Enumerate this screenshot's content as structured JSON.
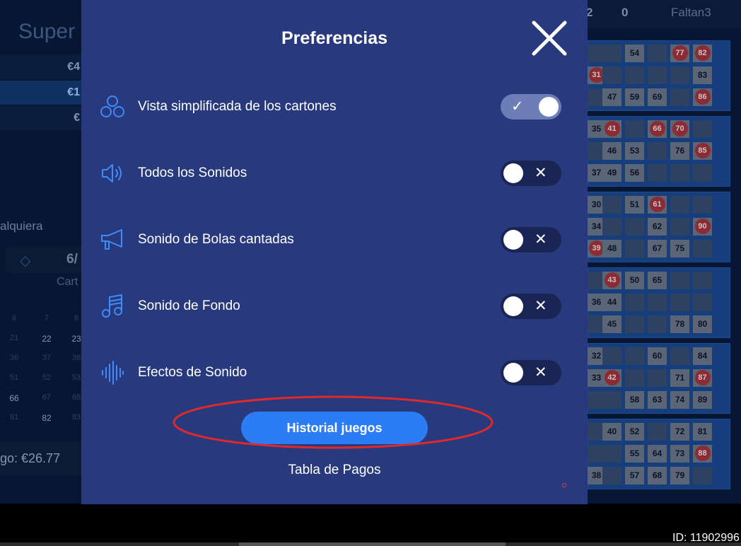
{
  "background": {
    "title": "Super",
    "prize_rows": [
      "€4",
      "€1",
      "€"
    ],
    "any_label": "alquiera",
    "selector_value": "6/",
    "cards_label": "Cart",
    "number_grid": [
      {
        "v": "6"
      },
      {
        "v": "7"
      },
      {
        "v": "8"
      },
      {
        "v": "21"
      },
      {
        "v": "22",
        "hi": true
      },
      {
        "v": "23",
        "hi": true
      },
      {
        "v": "36"
      },
      {
        "v": "37"
      },
      {
        "v": "38"
      },
      {
        "v": "51"
      },
      {
        "v": "52"
      },
      {
        "v": "53"
      },
      {
        "v": "66",
        "hi": true
      },
      {
        "v": "67"
      },
      {
        "v": "68"
      },
      {
        "v": "81"
      },
      {
        "v": "82",
        "hi": true
      },
      {
        "v": "83"
      }
    ],
    "bottom_label": "go: €26.77",
    "top_numbers": [
      "2",
      "0"
    ],
    "faltan": "Faltan3",
    "id_text": "ID: 11902996",
    "cards": [
      [
        [
          {
            "t": ""
          },
          {
            "t": ""
          },
          {
            "t": "54",
            "k": "num"
          },
          {
            "t": ""
          },
          {
            "t": "77",
            "k": "ball"
          },
          {
            "t": "82",
            "k": "ball"
          }
        ],
        [
          {
            "t": "31",
            "k": "ball"
          },
          {
            "t": ""
          },
          {
            "t": ""
          },
          {
            "t": ""
          },
          {
            "t": ""
          },
          {
            "t": "83",
            "k": "num"
          }
        ],
        [
          {
            "t": ""
          },
          {
            "t": "47",
            "k": "num"
          },
          {
            "t": "59",
            "k": "num"
          },
          {
            "t": "69",
            "k": "num"
          },
          {
            "t": ""
          },
          {
            "t": "86",
            "k": "ball"
          }
        ]
      ],
      [
        [
          {
            "t": "35",
            "k": "num"
          },
          {
            "t": "41",
            "k": "ball"
          },
          {
            "t": ""
          },
          {
            "t": "66",
            "k": "ball"
          },
          {
            "t": "70",
            "k": "ball"
          },
          {
            "t": ""
          }
        ],
        [
          {
            "t": ""
          },
          {
            "t": "46",
            "k": "num"
          },
          {
            "t": "53",
            "k": "num"
          },
          {
            "t": ""
          },
          {
            "t": "76",
            "k": "num"
          },
          {
            "t": "85",
            "k": "ball"
          }
        ],
        [
          {
            "t": "37",
            "k": "num"
          },
          {
            "t": "49",
            "k": "num"
          },
          {
            "t": "56",
            "k": "num"
          },
          {
            "t": ""
          },
          {
            "t": ""
          },
          {
            "t": ""
          }
        ]
      ],
      [
        [
          {
            "t": "30",
            "k": "num"
          },
          {
            "t": ""
          },
          {
            "t": "51",
            "k": "num"
          },
          {
            "t": "61",
            "k": "ball"
          },
          {
            "t": ""
          },
          {
            "t": ""
          }
        ],
        [
          {
            "t": "34",
            "k": "num"
          },
          {
            "t": ""
          },
          {
            "t": ""
          },
          {
            "t": "62",
            "k": "num"
          },
          {
            "t": ""
          },
          {
            "t": "90",
            "k": "ball"
          }
        ],
        [
          {
            "t": "39",
            "k": "ball"
          },
          {
            "t": "48",
            "k": "num"
          },
          {
            "t": ""
          },
          {
            "t": "67",
            "k": "num"
          },
          {
            "t": "75",
            "k": "num"
          },
          {
            "t": ""
          }
        ]
      ],
      [
        [
          {
            "t": ""
          },
          {
            "t": "43",
            "k": "ball"
          },
          {
            "t": "50",
            "k": "num"
          },
          {
            "t": "65",
            "k": "num"
          },
          {
            "t": ""
          },
          {
            "t": ""
          }
        ],
        [
          {
            "t": "36",
            "k": "num"
          },
          {
            "t": "44",
            "k": "num"
          },
          {
            "t": ""
          },
          {
            "t": ""
          },
          {
            "t": ""
          },
          {
            "t": ""
          }
        ],
        [
          {
            "t": ""
          },
          {
            "t": "45",
            "k": "num"
          },
          {
            "t": ""
          },
          {
            "t": ""
          },
          {
            "t": "78",
            "k": "num"
          },
          {
            "t": "80",
            "k": "num"
          }
        ]
      ],
      [
        [
          {
            "t": "32",
            "k": "num"
          },
          {
            "t": ""
          },
          {
            "t": ""
          },
          {
            "t": "60",
            "k": "num"
          },
          {
            "t": ""
          },
          {
            "t": "84",
            "k": "num"
          }
        ],
        [
          {
            "t": "33",
            "k": "num"
          },
          {
            "t": "42",
            "k": "ball"
          },
          {
            "t": ""
          },
          {
            "t": ""
          },
          {
            "t": "71",
            "k": "num"
          },
          {
            "t": "87",
            "k": "ball"
          }
        ],
        [
          {
            "t": ""
          },
          {
            "t": ""
          },
          {
            "t": "58",
            "k": "num"
          },
          {
            "t": "63",
            "k": "num"
          },
          {
            "t": "74",
            "k": "num"
          },
          {
            "t": "89",
            "k": "num"
          }
        ]
      ],
      [
        [
          {
            "t": ""
          },
          {
            "t": "40",
            "k": "num"
          },
          {
            "t": "52",
            "k": "num"
          },
          {
            "t": ""
          },
          {
            "t": "72",
            "k": "num"
          },
          {
            "t": "81",
            "k": "num"
          }
        ],
        [
          {
            "t": ""
          },
          {
            "t": ""
          },
          {
            "t": "55",
            "k": "num"
          },
          {
            "t": "64",
            "k": "num"
          },
          {
            "t": "73",
            "k": "num"
          },
          {
            "t": "88",
            "k": "ball"
          }
        ],
        [
          {
            "t": "38",
            "k": "num"
          },
          {
            "t": ""
          },
          {
            "t": "57",
            "k": "num"
          },
          {
            "t": "68",
            "k": "num"
          },
          {
            "t": "79",
            "k": "num"
          },
          {
            "t": ""
          }
        ]
      ]
    ]
  },
  "modal": {
    "title": "Preferencias",
    "close_icon": "close-icon",
    "preferences": [
      {
        "icon": "circles-icon",
        "label": "Vista simplificada de los cartones",
        "enabled": true
      },
      {
        "icon": "speaker-icon",
        "label": "Todos los Sonidos",
        "enabled": false
      },
      {
        "icon": "megaphone-icon",
        "label": "Sonido de Bolas cantadas",
        "enabled": false
      },
      {
        "icon": "music-note-icon",
        "label": "Sonido de Fondo",
        "enabled": false
      },
      {
        "icon": "sound-wave-icon",
        "label": "Efectos de Sonido",
        "enabled": false
      }
    ],
    "toggle_on_mark": "✓",
    "toggle_off_mark": "✕",
    "history_button_label": "Historial juegos",
    "pay_table_label": "Tabla de Pagos",
    "colors": {
      "modal_bg": "#28397e",
      "accent_blue": "#2b7cf5",
      "icon_blue": "#3d8cf7",
      "annotation_red": "#e02a2a"
    }
  }
}
